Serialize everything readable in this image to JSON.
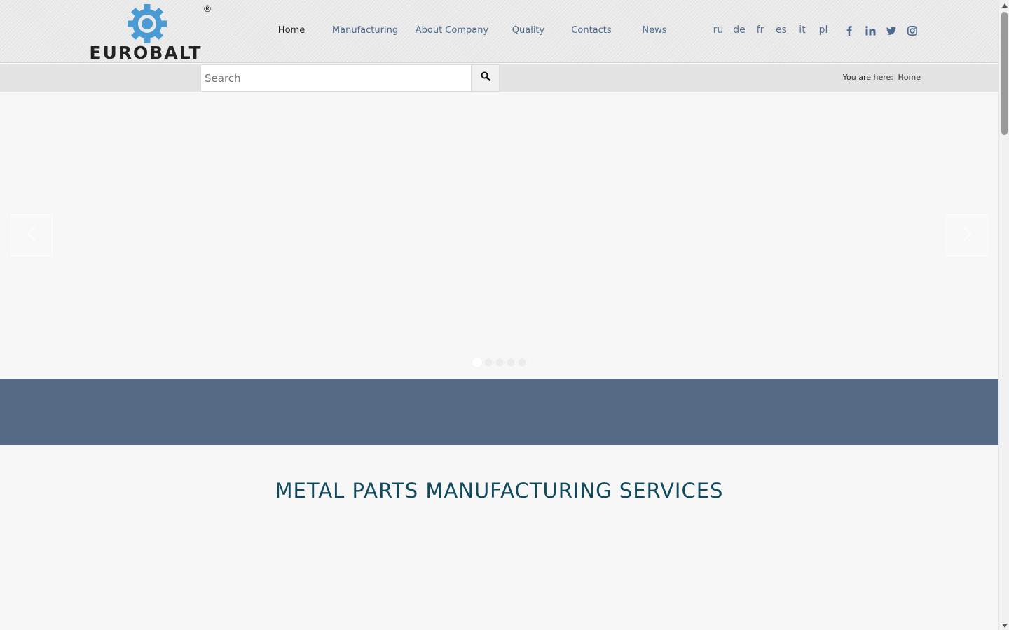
{
  "brand": {
    "name": "EUROBALT",
    "registered_mark": "®"
  },
  "nav": {
    "items": [
      {
        "label": "Home",
        "active": true
      },
      {
        "label": "Manufacturing",
        "active": false
      },
      {
        "label": "About Company",
        "active": false
      },
      {
        "label": "Quality",
        "active": false
      },
      {
        "label": "Contacts",
        "active": false
      },
      {
        "label": "News",
        "active": false
      }
    ]
  },
  "languages": [
    "ru",
    "de",
    "fr",
    "es",
    "it",
    "pl"
  ],
  "social": [
    "facebook-icon",
    "linkedin-icon",
    "twitter-icon",
    "instagram-icon"
  ],
  "search": {
    "placeholder": "Search",
    "value": ""
  },
  "breadcrumb": {
    "prefix": "You are here:",
    "current": "Home"
  },
  "slider": {
    "slide_count": 5,
    "active_slide": 1
  },
  "section": {
    "title": "METAL PARTS MANUFACTURING SERVICES"
  },
  "colors": {
    "nav_link": "#4d6b8e",
    "nav_active": "#222222",
    "band": "#566985",
    "title": "#0f4a5e",
    "logo_gear": "#4a9ad4",
    "logo_text": "#222222"
  }
}
